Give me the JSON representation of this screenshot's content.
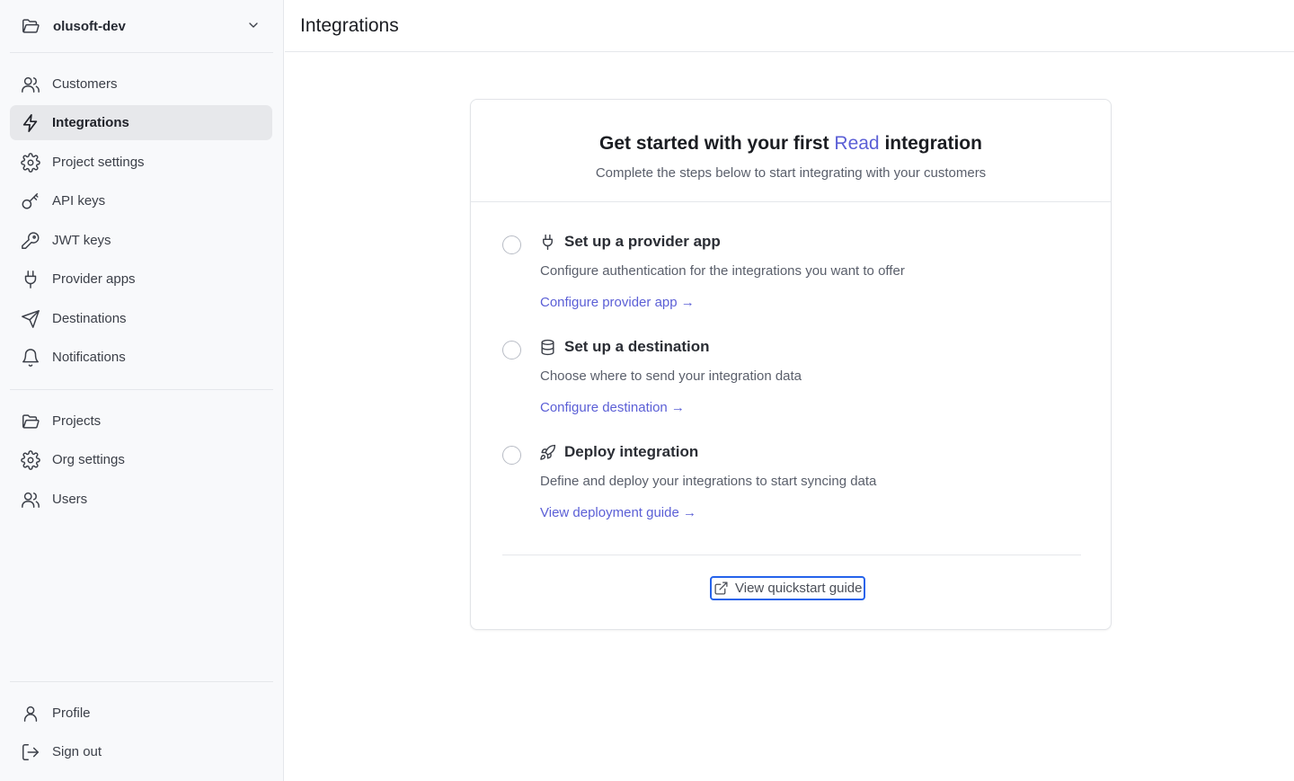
{
  "sidebar": {
    "project": {
      "name": "olusoft-dev",
      "icon": "folder-icon",
      "dropdown_icon": "chevron-down-icon"
    },
    "primary_nav": [
      {
        "label": "Customers",
        "icon": "users-icon",
        "active": false
      },
      {
        "label": "Integrations",
        "icon": "zap-icon",
        "active": true
      },
      {
        "label": "Project settings",
        "icon": "gear-icon",
        "active": false
      },
      {
        "label": "API keys",
        "icon": "key-icon",
        "active": false
      },
      {
        "label": "JWT keys",
        "icon": "key-round-icon",
        "active": false
      },
      {
        "label": "Provider apps",
        "icon": "plug-icon",
        "active": false
      },
      {
        "label": "Destinations",
        "icon": "send-icon",
        "active": false
      },
      {
        "label": "Notifications",
        "icon": "bell-icon",
        "active": false
      }
    ],
    "org_nav": [
      {
        "label": "Projects",
        "icon": "folder-icon"
      },
      {
        "label": "Org settings",
        "icon": "gear-icon"
      },
      {
        "label": "Users",
        "icon": "users-icon"
      }
    ],
    "footer_nav": [
      {
        "label": "Profile",
        "icon": "user-icon"
      },
      {
        "label": "Sign out",
        "icon": "sign-out-icon"
      }
    ]
  },
  "header": {
    "title": "Integrations"
  },
  "card": {
    "title_before": "Get started with your first ",
    "title_accent": "Read",
    "title_after": " integration",
    "subtitle": "Complete the steps below to start integrating with your customers",
    "steps": [
      {
        "title": "Set up a provider app",
        "icon": "plug-icon",
        "description": "Configure authentication for the integrations you want to offer",
        "link": "Configure provider app →",
        "completed": false
      },
      {
        "title": "Set up a destination",
        "icon": "database-icon",
        "description": "Choose where to send your integration data",
        "link": "Configure destination →",
        "completed": false
      },
      {
        "title": "Deploy integration",
        "icon": "rocket-icon",
        "description": "Define and deploy your integrations to start syncing data",
        "link": "View deployment guide →",
        "completed": false
      }
    ],
    "quickstart_button": {
      "label": "View quickstart guide",
      "icon": "external-link-icon"
    }
  },
  "colors": {
    "accent": "#5b5fd6",
    "sidebar_bg": "#f8f9fb",
    "active_nav_bg": "#e7e8eb",
    "focus_ring": "#2563eb",
    "border": "#e5e7eb"
  }
}
